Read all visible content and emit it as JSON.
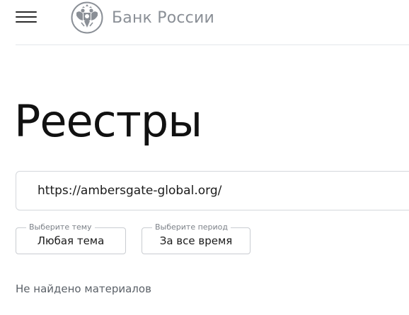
{
  "header": {
    "menu_icon": "hamburger-menu-icon",
    "logo_icon": "double-headed-eagle-emblem-icon",
    "logo_text": "Банк России",
    "logo_color": "#8a8f96"
  },
  "page": {
    "title": "Реестры"
  },
  "search": {
    "value": "https://ambersgate-global.org/"
  },
  "filters": {
    "topic": {
      "legend": "Выберите тему",
      "value": "Любая тема"
    },
    "period": {
      "legend": "Выберите период",
      "value": "За все время"
    }
  },
  "results": {
    "empty_message": "Не найдено материалов"
  }
}
